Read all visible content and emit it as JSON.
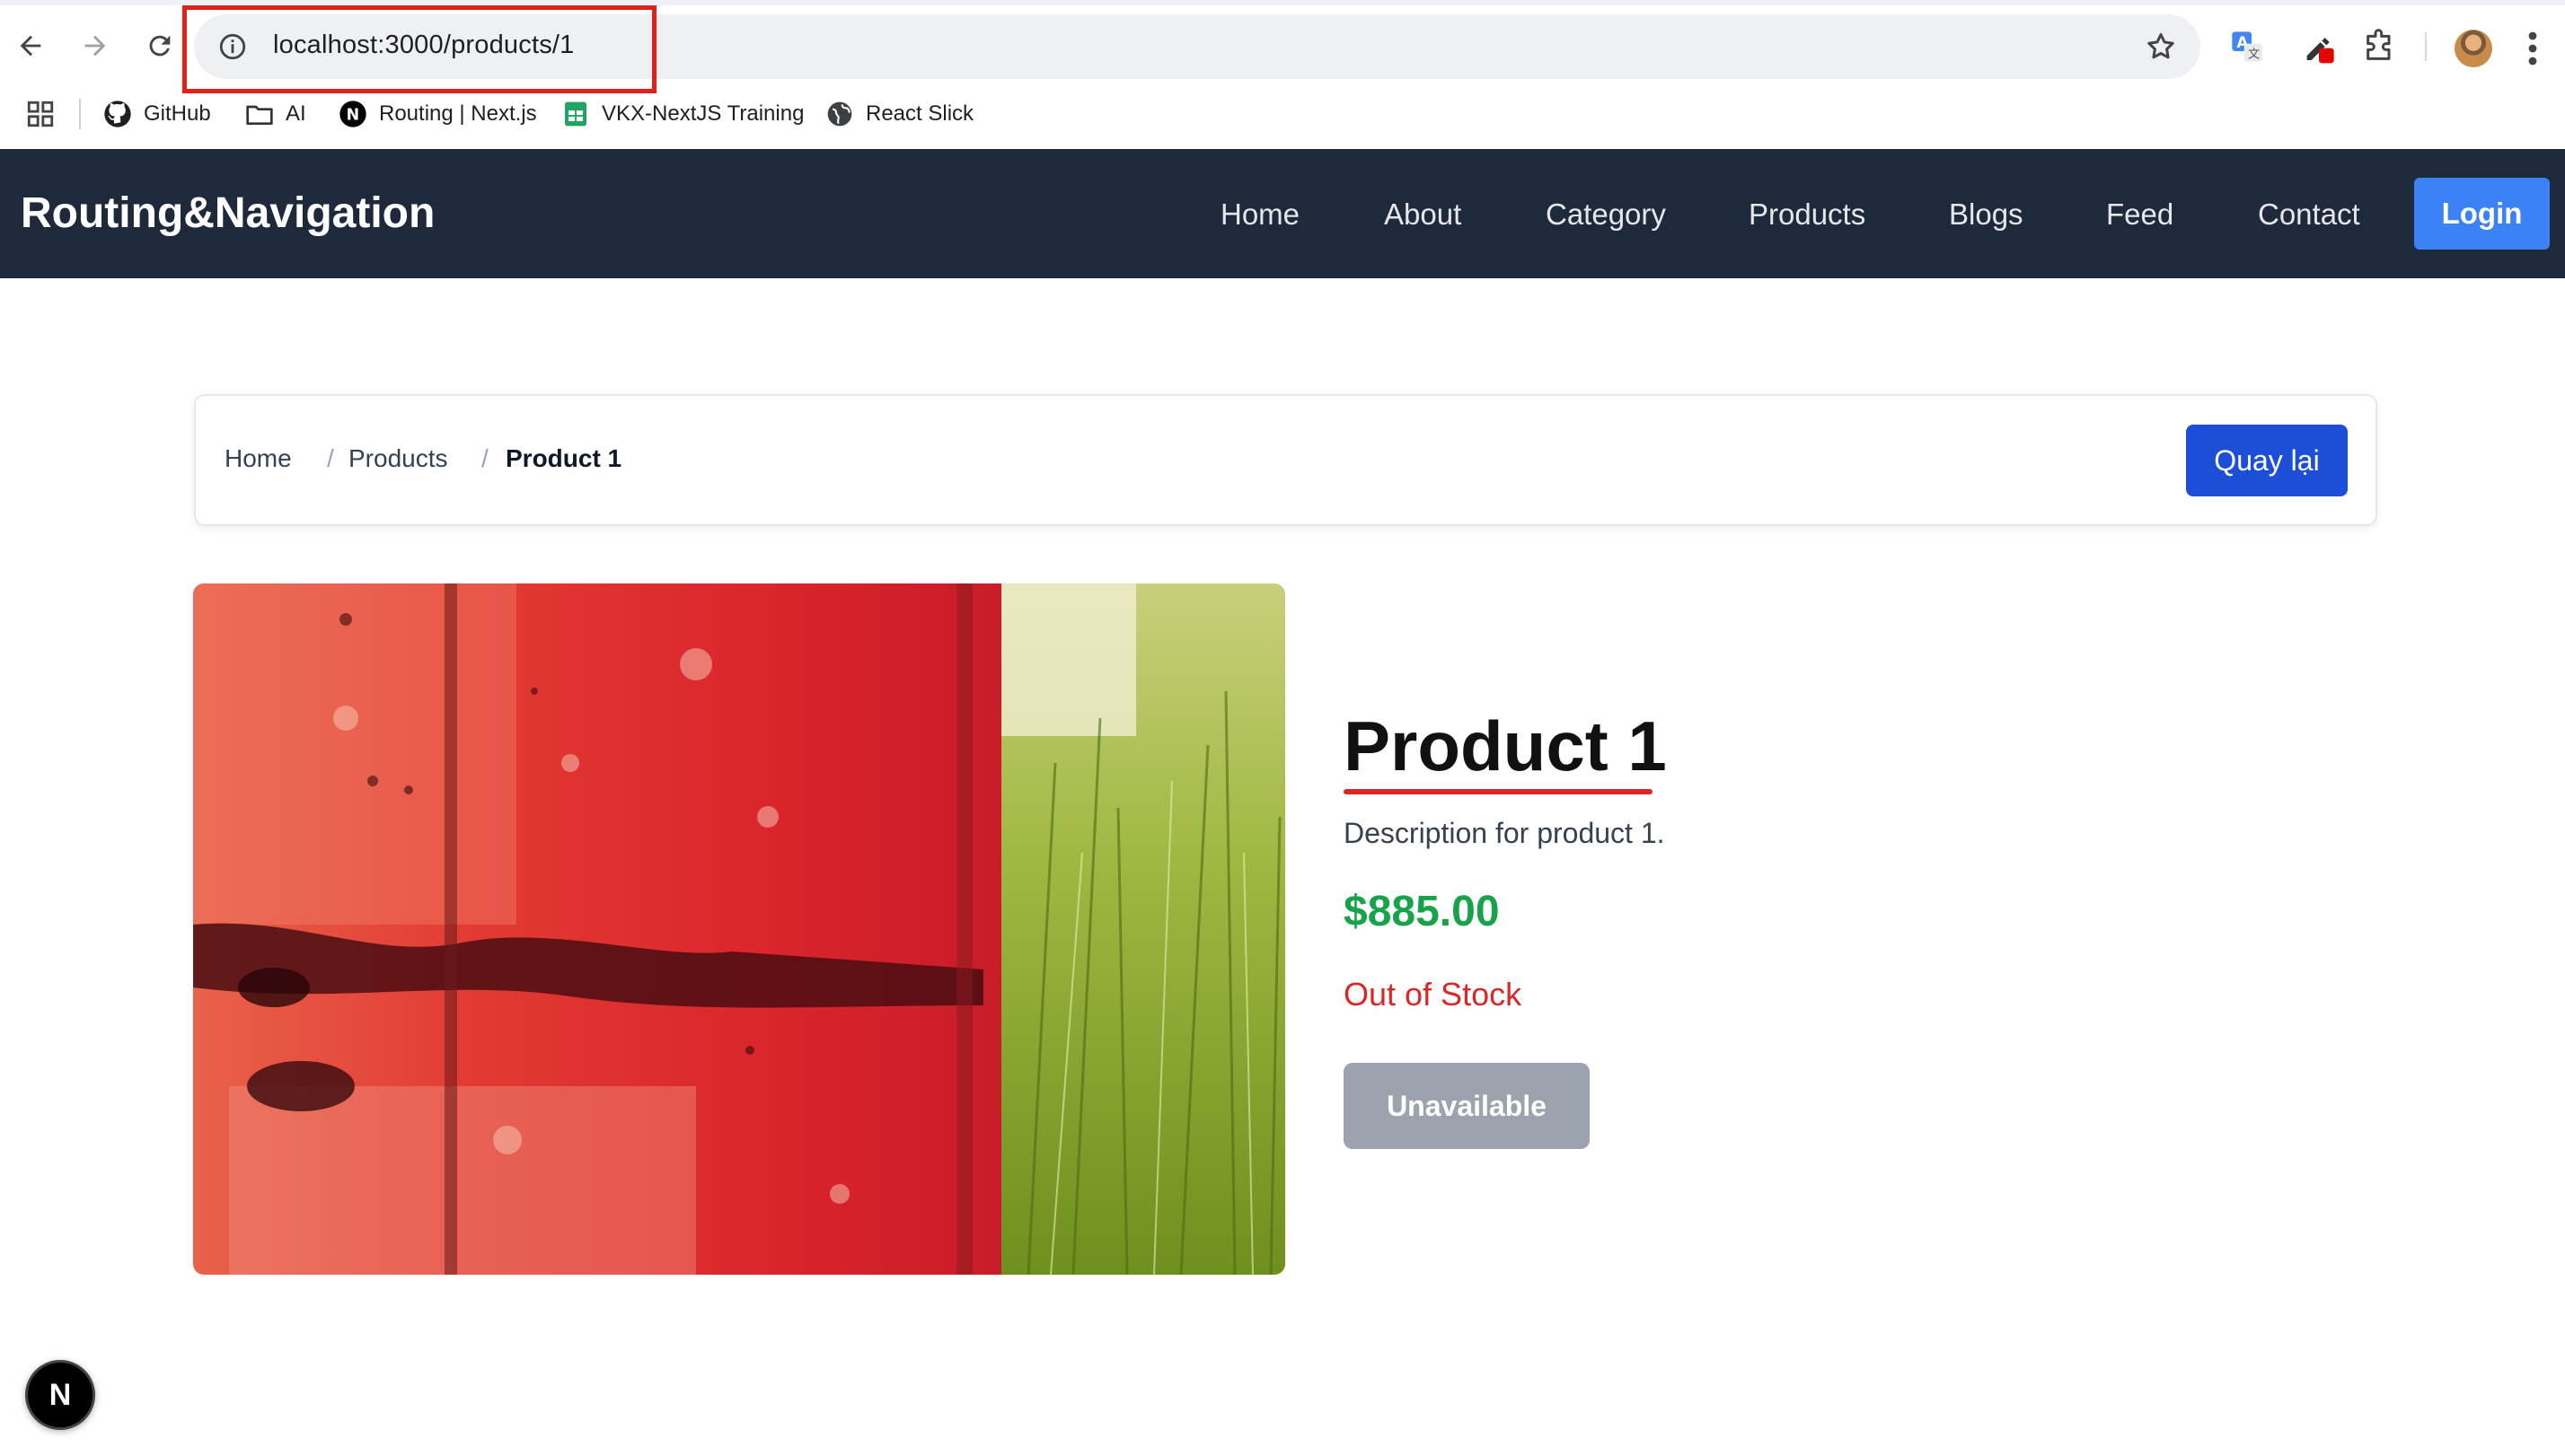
{
  "browser": {
    "url": "localhost:3000/products/1",
    "bookmarks": [
      {
        "label": "GitHub",
        "icon": "github-icon"
      },
      {
        "label": "AI",
        "icon": "folder-icon"
      },
      {
        "label": "Routing | Next.js",
        "icon": "nextjs-icon"
      },
      {
        "label": "VKX-NextJS Training",
        "icon": "sheets-icon"
      },
      {
        "label": "React Slick",
        "icon": "globe-icon"
      }
    ]
  },
  "navbar": {
    "brand": "Routing&Navigation",
    "links": [
      "Home",
      "About",
      "Category",
      "Products",
      "Blogs",
      "Feed",
      "Contact"
    ],
    "login_label": "Login",
    "background": "#1e293b",
    "login_color": "#3b82f6"
  },
  "breadcrumb": {
    "items": [
      "Home",
      "Products",
      "Product 1"
    ],
    "separator": "/",
    "back_label": "Quay lại"
  },
  "product": {
    "title": "Product 1",
    "description": "Description for product 1.",
    "price": "$885.00",
    "stock": "Out of Stock",
    "action_label": "Unavailable",
    "price_color": "#16a34a",
    "stock_color": "#dc2626"
  },
  "devtools": {
    "badge": "N"
  }
}
